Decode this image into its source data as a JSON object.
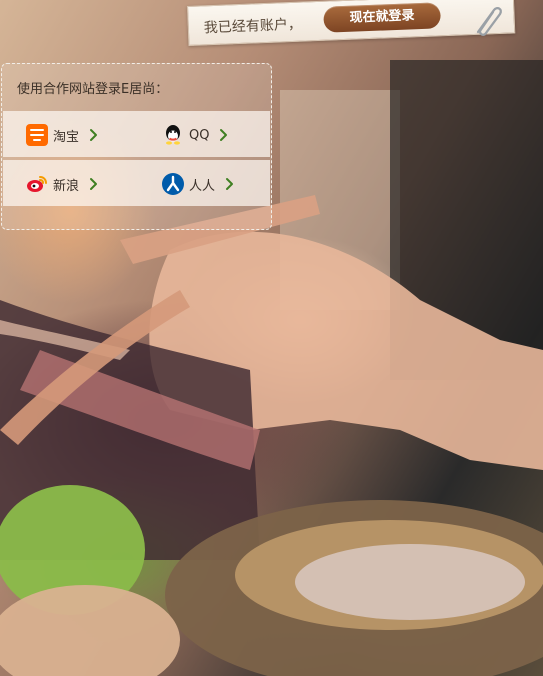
{
  "header": {
    "register_prompt": "我已经有账户，",
    "login_now_label": "现在就登录"
  },
  "login_panel": {
    "title": "使用合作网站登录E居尚：",
    "providers": [
      {
        "label": "淘宝",
        "icon": "taobao-icon"
      },
      {
        "label": "QQ",
        "icon": "qq-icon"
      },
      {
        "label": "新浪",
        "icon": "weibo-icon"
      },
      {
        "label": "人人",
        "icon": "renren-icon"
      }
    ]
  },
  "colors": {
    "arrow_green": "#3f7f22",
    "button_brown": "#7d4423",
    "panel_text": "#3b3027"
  }
}
